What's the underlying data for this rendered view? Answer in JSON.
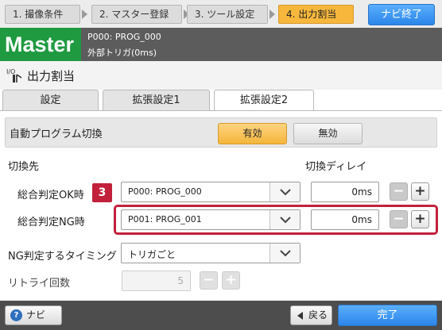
{
  "steps": [
    {
      "label": "1. 撮像条件",
      "active": false
    },
    {
      "label": "2. マスター登録",
      "active": false
    },
    {
      "label": "3. ツール設定",
      "active": false
    },
    {
      "label": "4. 出力割当",
      "active": true
    }
  ],
  "navi_end_label": "ナビ終了",
  "banner": {
    "logo": "Master",
    "line1": "P000: PROG_000",
    "line2": "外部トリガ(0ms)"
  },
  "page": {
    "icon_text": "I/O",
    "title": "出力割当"
  },
  "tabs": [
    {
      "label": "設定",
      "active": false
    },
    {
      "label": "拡張設定1",
      "active": false
    },
    {
      "label": "拡張設定2",
      "active": true
    }
  ],
  "auto_switch": {
    "label": "自動プログラム切換",
    "enabled_label": "有効",
    "disabled_label": "無効",
    "selected": "有効"
  },
  "switch_dest": {
    "header": "切換先",
    "delay_header": "切換ディレイ",
    "badge": "3",
    "ok_row": {
      "label": "総合判定OK時",
      "program": "P000: PROG_000",
      "delay": "0ms"
    },
    "ng_row": {
      "label": "総合判定NG時",
      "program": "P001: PROG_001",
      "delay": "0ms"
    }
  },
  "ng_timing": {
    "label": "NG判定するタイミング",
    "value": "トリガごと"
  },
  "retry": {
    "label": "リトライ回数",
    "value": "5"
  },
  "footer": {
    "navi_label": "ナビ",
    "back_label": "戻る",
    "done_label": "完了"
  },
  "colors": {
    "accent_orange": "#f6b73c",
    "accent_blue": "#2b86ea",
    "master_green": "#1f9a40",
    "highlight_red": "#c2203b"
  }
}
